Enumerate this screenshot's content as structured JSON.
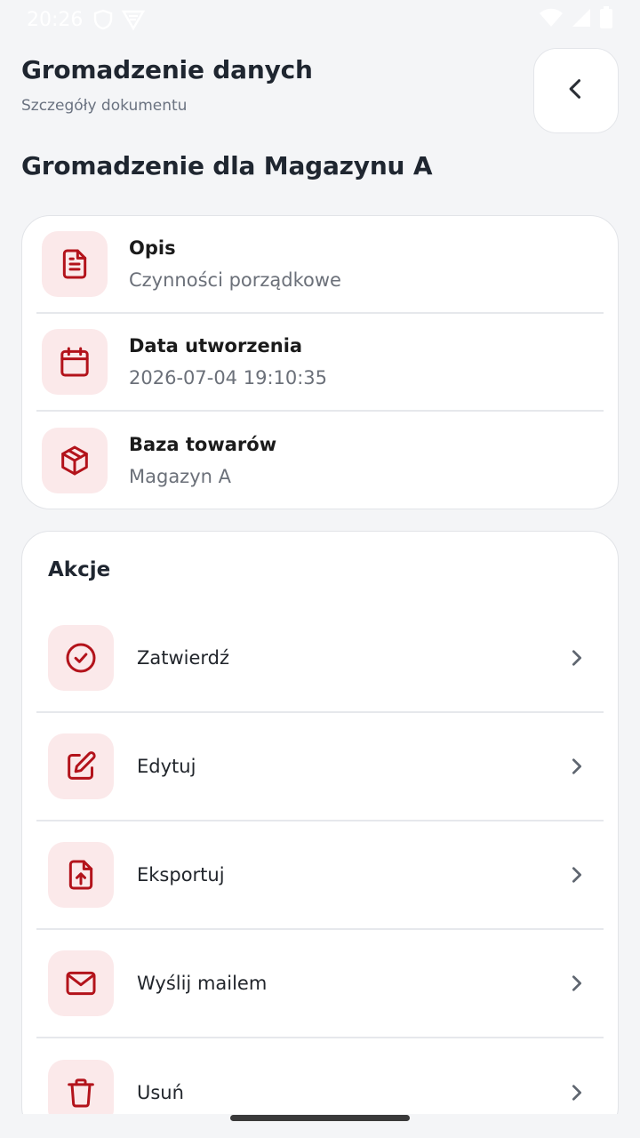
{
  "status_bar": {
    "time": "20:26"
  },
  "header": {
    "title": "Gromadzenie danych",
    "subtitle": "Szczegóły dokumentu"
  },
  "document": {
    "title": "Gromadzenie dla Magazynu A",
    "info": [
      {
        "label": "Opis",
        "value": "Czynności porządkowe",
        "icon": "document-icon"
      },
      {
        "label": "Data utworzenia",
        "value": "2026-07-04 19:10:35",
        "icon": "calendar-icon"
      },
      {
        "label": "Baza towarów",
        "value": "Magazyn A",
        "icon": "box-icon"
      }
    ]
  },
  "actions": {
    "title": "Akcje",
    "items": [
      {
        "label": "Zatwierdź",
        "icon": "check-circle-icon"
      },
      {
        "label": "Edytuj",
        "icon": "edit-icon"
      },
      {
        "label": "Eksportuj",
        "icon": "file-upload-icon"
      },
      {
        "label": "Wyślij mailem",
        "icon": "mail-icon"
      },
      {
        "label": "Usuń",
        "icon": "trash-icon"
      }
    ]
  },
  "colors": {
    "accent": "#b3131b",
    "accent_bg": "#fbe9ea",
    "background": "#f4f5f7"
  }
}
